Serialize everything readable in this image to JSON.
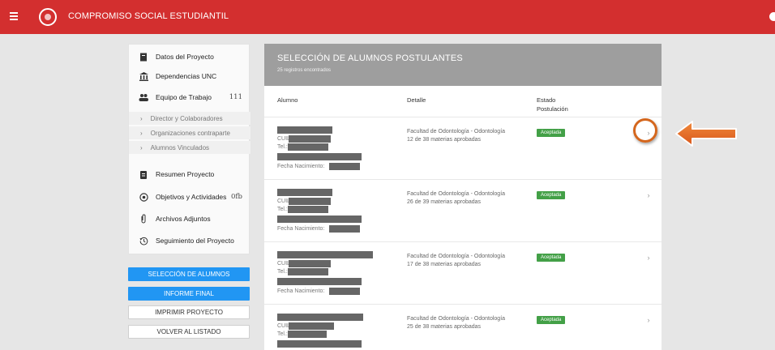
{
  "header": {
    "title": "COMPROMISO SOCIAL ESTUDIANTIL"
  },
  "sidebar": {
    "items": [
      {
        "label": "Datos del Proyecto",
        "icon": "document-icon"
      },
      {
        "label": "Dependencias UNC",
        "icon": "institution-icon"
      },
      {
        "label": "Equipo de Trabajo",
        "icon": "people-icon",
        "count": "111"
      },
      {
        "label": "Resumen Proyecto",
        "icon": "clipboard-icon"
      },
      {
        "label": "Objetivos y Actividades",
        "icon": "target-icon",
        "count": "0fb"
      },
      {
        "label": "Archivos Adjuntos",
        "icon": "paperclip-icon"
      },
      {
        "label": "Seguimiento del Proyecto",
        "icon": "history-icon"
      }
    ],
    "subitems": [
      {
        "label": "Director y Colaboradores"
      },
      {
        "label": "Organizaciones contraparte"
      },
      {
        "label": "Alumnos Vinculados"
      }
    ],
    "buttons": {
      "seleccion": "SELECCIÓN DE ALUMNOS",
      "informe": "INFORME FINAL",
      "imprimir": "IMPRIMIR PROYECTO",
      "volver": "VOLVER AL LISTADO"
    }
  },
  "panel": {
    "title": "SELECCIÓN DE ALUMNOS POSTULANTES",
    "subtitle": "25 registros encontrados",
    "columns": {
      "alumno": "Alumno",
      "detalle": "Detalle",
      "estado": "Estado\nPostulación"
    },
    "labels": {
      "cuil": "CUIL:",
      "tel": "Tel.:",
      "fecha": "Fecha Nacimiento:"
    },
    "rows": [
      {
        "facultad": "Facultad de Odontología - Odontología",
        "materias": "12 de 38 materias aprobadas",
        "estado": "Aceptada"
      },
      {
        "facultad": "Facultad de Odontología - Odontología",
        "materias": "26 de 39 materias aprobadas",
        "estado": "Aceptada"
      },
      {
        "facultad": "Facultad de Odontología - Odontología",
        "materias": "17 de 38 materias aprobadas",
        "estado": "Aceptada"
      },
      {
        "facultad": "Facultad de Odontología - Odontología",
        "materias": "25 de 38 materias aprobadas",
        "estado": "Aceptada"
      }
    ]
  },
  "colors": {
    "topbar": "#d32f2f",
    "accent_blue": "#2196f3",
    "badge_green": "#43a047",
    "annotation": "#e8641c"
  }
}
